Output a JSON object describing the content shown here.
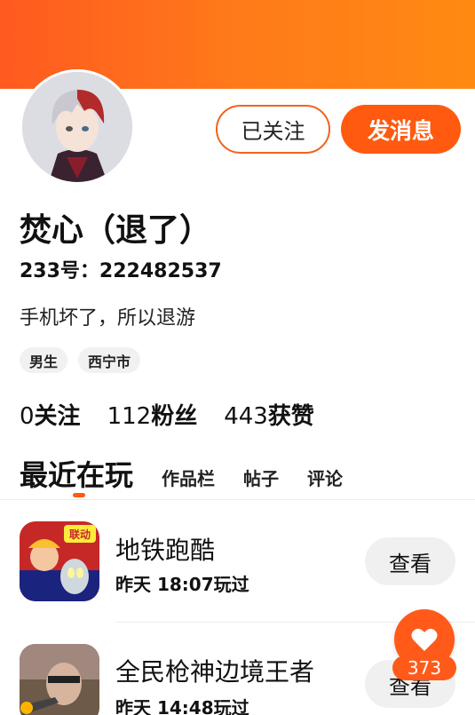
{
  "profile": {
    "name": "焚心（退了）",
    "uid": "233号：222482537",
    "bio": "手机坏了，所以退游",
    "tags": [
      "男生",
      "西宁市"
    ]
  },
  "actions": {
    "followed_label": "已关注",
    "message_label": "发消息"
  },
  "stats": [
    {
      "value": "0",
      "label": "关注"
    },
    {
      "value": "112",
      "label": "粉丝"
    },
    {
      "value": "443",
      "label": "获赞"
    }
  ],
  "tabs": {
    "active": "最近在玩",
    "items": [
      "作品栏",
      "帖子",
      "评论"
    ]
  },
  "games": [
    {
      "title": "地铁跑酷",
      "time": "昨天 18:07玩过",
      "button": "查看",
      "icon_badge": "联动"
    },
    {
      "title": "全民枪神边境王者",
      "time": "昨天 14:48玩过",
      "button": "查看"
    }
  ],
  "like": {
    "count": "373",
    "icon": "heart-icon"
  },
  "colors": {
    "accent": "#ff5a0f",
    "banner_start": "#ff5a1f",
    "banner_end": "#ff8a12"
  }
}
